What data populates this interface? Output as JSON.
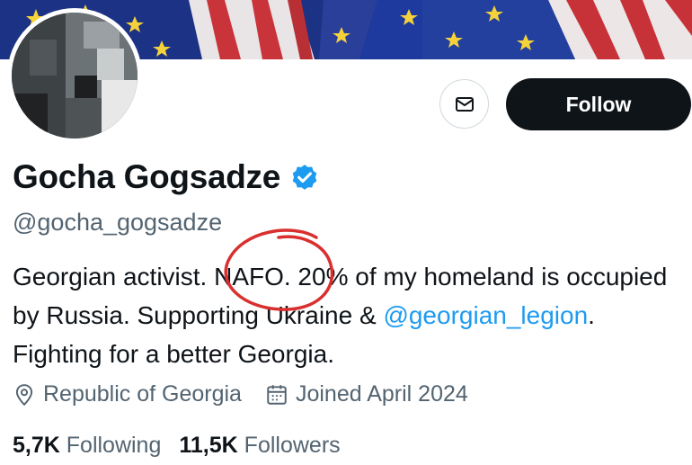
{
  "profile": {
    "name": "Gocha Gogsadze",
    "handle": "@gocha_gogsadze",
    "bio_part1": "Georgian activist. NAFO. 20% of my homeland is occupied by Russia. Supporting Ukraine & ",
    "bio_mention": "@georgian_legion",
    "bio_part2": ". Fighting for a better Georgia.",
    "location": "Republic of Georgia",
    "joined": "Joined April 2024",
    "following_count": "5,7K",
    "following_label": "Following",
    "followers_count": "11,5K",
    "followers_label": "Followers"
  },
  "actions": {
    "follow_label": "Follow",
    "message_icon": "envelope-icon"
  },
  "colors": {
    "link": "#1d9bf0",
    "verified": "#1d9bf0",
    "secondary_text": "#536471",
    "follow_bg": "#0f1419",
    "annotation": "#d9302f"
  }
}
